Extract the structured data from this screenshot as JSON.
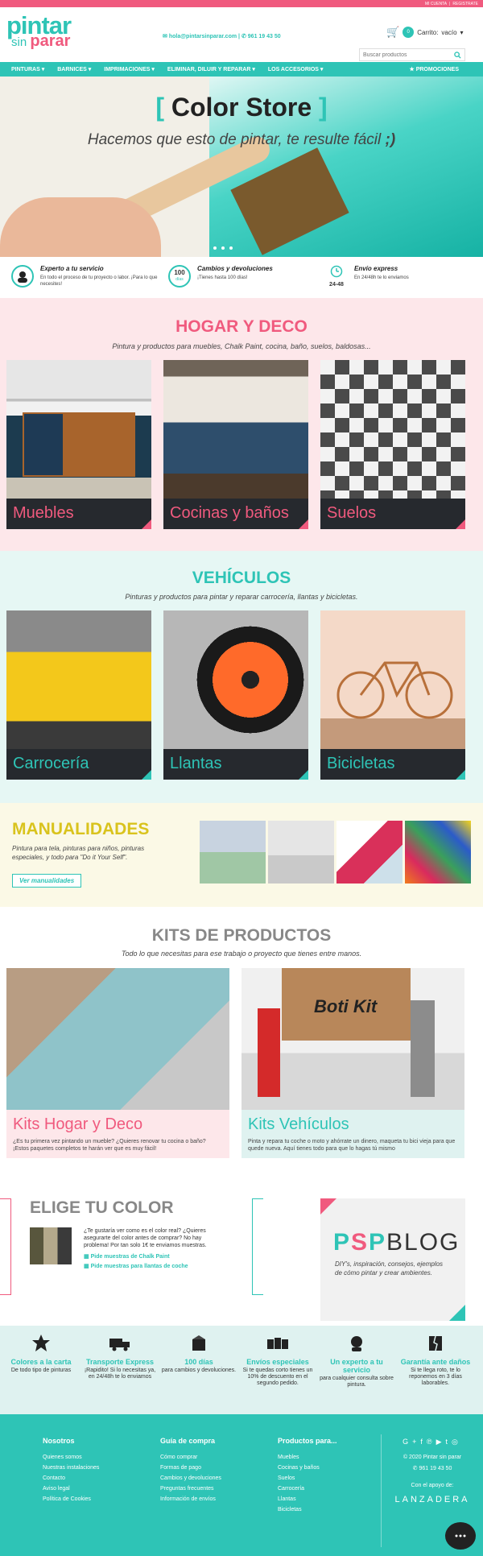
{
  "top": {
    "account": "MI CUENTA",
    "register": "REGISTRATE"
  },
  "header": {
    "logo_line1": "pintar",
    "logo_line2a": "sin",
    "logo_line2b": "parar",
    "email": "hola@pintarsinparar.com",
    "phone": "961 19 43 50",
    "cart_count": "0",
    "cart_label": "Carrito:",
    "cart_status": "vacío",
    "search_placeholder": "Buscar productos"
  },
  "nav": {
    "items": [
      "PINTURAS",
      "BARNICES",
      "IMPRIMACIONES",
      "ELIMINAR, DILUIR Y REPARAR",
      "LOS ACCESORIOS"
    ],
    "promo": "PROMOCIONES"
  },
  "hero": {
    "bracket_left": "[",
    "title": "Color Store",
    "bracket_right": "]",
    "subtitle": "Hacemos que esto de pintar, te resulte fácil",
    "wink": ";)"
  },
  "features": [
    {
      "icon": "expert-icon",
      "title": "Experto a tu servicio",
      "desc": "En todo el proceso de tu proyecto o labor. ¡Para lo que necesites!"
    },
    {
      "icon_text": "100",
      "icon_text2": "días",
      "title": "Cambios y devoluciones",
      "desc": "¡Tienes hasta 100 días!"
    },
    {
      "icon": "clock-icon",
      "icon_text": "24-48",
      "title": "Envío express",
      "desc": "En 24/48h te lo enviamos"
    }
  ],
  "hogar": {
    "title": "HOGAR Y DECO",
    "subtitle": "Pintura y productos para muebles, Chalk Paint, cocina, baño, suelos, baldosas...",
    "cards": [
      "Muebles",
      "Cocinas y baños",
      "Suelos"
    ]
  },
  "vehiculos": {
    "title": "VEHÍCULOS",
    "subtitle": "Pinturas y productos para pintar y reparar carrocería, llantas y bicicletas.",
    "cards": [
      "Carrocería",
      "Llantas",
      "Bicicletas"
    ]
  },
  "manualidades": {
    "title": "MANUALIDADES",
    "desc": "Pintura para tela, pinturas para niños, pinturas especiales, y todo para \"Do it Your Self\".",
    "button": "Ver manualidades"
  },
  "kits": {
    "title": "KITS DE PRODUCTOS",
    "subtitle": "Todo lo que necesitas para ese trabajo o proyecto que tienes entre manos.",
    "boti_label": "Boti Kit",
    "cards": [
      {
        "title": "Kits Hogar y Deco",
        "desc": "¿Es tu primera vez pintando un mueble? ¿Quieres renovar tu cocina o baño? ¡Estos paquetes completos te harán ver que es muy fácil!"
      },
      {
        "title": "Kits Vehículos",
        "desc": "Pinta y repara tu coche o moto y ahórrate un dinero, maqueta tu bici vieja para que quede nueva. Aquí tienes todo para que lo hagas tú mismo"
      }
    ]
  },
  "elige": {
    "title": "ELIGE TU COLOR",
    "desc": "¿Te gustaría ver como es el color real? ¿Quieres asegurarte del color antes de comprar? No hay problema! Por tan solo 1€ te enviamos muestras.",
    "link1": "Pide muestras de Chalk Paint",
    "link2": "Pide muestras para llantas de coche"
  },
  "blog": {
    "psp": "PSP",
    "blog": "BLOG",
    "desc": "DIY's, inspiración, consejos, ejemplos de cómo pintar y crear ambientes."
  },
  "benefits": [
    {
      "title": "Colores a la carta",
      "desc": "De todo tipo de pinturas"
    },
    {
      "title": "Transporte Express",
      "desc": "¡Rapidito! Si lo necesitas ya, en 24/48h te lo enviamos"
    },
    {
      "title": "100 días",
      "desc": "para cambios y devoluciones."
    },
    {
      "title": "Envíos especiales",
      "desc": "Si te quedas corto tienes un 10% de descuento en el segundo pedido."
    },
    {
      "title": "Un experto a tu servicio",
      "desc": "para cualquier consulta sobre pintura."
    },
    {
      "title": "Garantía ante daños",
      "desc": "Si te llega roto, te lo reponemos en 3 días laborables."
    }
  ],
  "footer": {
    "cols": [
      {
        "title": "Nosotros",
        "links": [
          "Quienes somos",
          "Nuestras instalaciones",
          "Contacto",
          "Aviso legal",
          "Política de Cookies"
        ]
      },
      {
        "title": "Guía de compra",
        "links": [
          "Cómo comprar",
          "Formas de pago",
          "Cambios y devoluciones",
          "Preguntas frecuentes",
          "Información de envíos"
        ]
      },
      {
        "title": "Productos para...",
        "links": [
          "Muebles",
          "Cocinas y baños",
          "Suelos",
          "Carrocería",
          "Llantas",
          "Bicicletas"
        ]
      }
    ],
    "copyright": "© 2020 Pintar sin parar",
    "phone": "961 19 43 50",
    "support": "Con el apoyo de:",
    "partner": "LANZADERA"
  },
  "colors": {
    "teal": "#2ec4b6",
    "pink": "#f05a7e",
    "yellow": "#d9c31d",
    "gray": "#888888"
  }
}
